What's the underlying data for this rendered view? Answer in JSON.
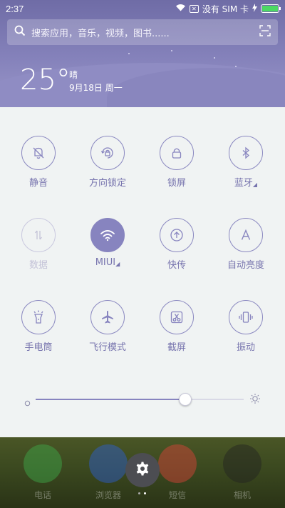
{
  "status_bar": {
    "time": "2:37",
    "carrier": "没有 SIM 卡",
    "icons": [
      "wifi-icon",
      "sim-x-icon",
      "charging-icon",
      "battery-icon"
    ],
    "battery_level": 1.0
  },
  "search": {
    "placeholder": "搜索应用，音乐，视频，图书......"
  },
  "weather": {
    "temperature": "25°",
    "condition": "晴",
    "date": "9月18日 周一"
  },
  "toggles": [
    {
      "label": "静音",
      "icon": "bell-mute-icon",
      "state": "off"
    },
    {
      "label": "方向锁定",
      "icon": "rotation-lock-icon",
      "state": "off"
    },
    {
      "label": "锁屏",
      "icon": "lock-icon",
      "state": "off"
    },
    {
      "label": "蓝牙",
      "icon": "bluetooth-icon",
      "state": "off",
      "expandable": true
    },
    {
      "label": "数据",
      "icon": "mobile-data-icon",
      "state": "disabled"
    },
    {
      "label": "MIUI",
      "icon": "wifi-icon",
      "state": "on",
      "expandable": true
    },
    {
      "label": "快传",
      "icon": "quick-transfer-icon",
      "state": "off"
    },
    {
      "label": "自动亮度",
      "icon": "auto-brightness-icon",
      "state": "off"
    },
    {
      "label": "手电筒",
      "icon": "flashlight-icon",
      "state": "off"
    },
    {
      "label": "飞行模式",
      "icon": "airplane-icon",
      "state": "off"
    },
    {
      "label": "截屏",
      "icon": "screenshot-icon",
      "state": "off"
    },
    {
      "label": "振动",
      "icon": "vibrate-icon",
      "state": "off"
    }
  ],
  "brightness": {
    "level": 0.72
  },
  "home": {
    "apps": [
      {
        "label": "电话",
        "color": "#3fae4c"
      },
      {
        "label": "浏览器",
        "color": "#2c5fd6"
      },
      {
        "label": "短信",
        "color": "#e0423a"
      },
      {
        "label": "相机",
        "color": "#222222"
      }
    ],
    "settings_icon": "gear-icon",
    "page_count": 2,
    "current_page": 1
  },
  "colors": {
    "accent": "#8784bf",
    "panel_bg": "#f0f3f3",
    "header_bg": "#7b78b0"
  }
}
